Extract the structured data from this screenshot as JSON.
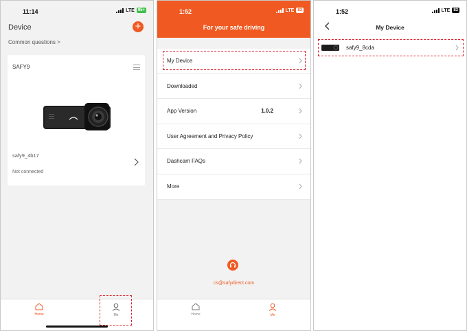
{
  "colors": {
    "accent": "#f05a22",
    "highlight": "#d9232e"
  },
  "panel1": {
    "time": "11:14",
    "network": "LTE",
    "battery": "95+",
    "title": "Device",
    "add_icon": "plus-icon",
    "common_questions": "Common questions >",
    "device_card": {
      "name": "SAFY9",
      "ssid": "safy9_4b17",
      "status": "Not connected"
    },
    "tabs": [
      {
        "label": "Home",
        "icon": "home-icon",
        "active": true
      },
      {
        "label": "Me",
        "icon": "user-icon",
        "active": false
      }
    ]
  },
  "panel2": {
    "time": "1:52",
    "network": "LTE",
    "battery": "83",
    "banner": "For your safe driving",
    "menu": [
      {
        "label": "My Device",
        "value": ""
      },
      {
        "label": "Downloaded",
        "value": ""
      },
      {
        "label": "App Version",
        "value": "1.0.2"
      },
      {
        "label": "User Agreement and Privacy Policy",
        "value": ""
      },
      {
        "label": "Dashcam FAQs",
        "value": ""
      },
      {
        "label": "More",
        "value": ""
      }
    ],
    "support_icon": "headset-icon",
    "email": "cs@safydirect.com",
    "tabs": [
      {
        "label": "Home",
        "icon": "home-icon",
        "active": false
      },
      {
        "label": "Me",
        "icon": "user-icon",
        "active": true
      }
    ]
  },
  "panel3": {
    "time": "1:52",
    "network": "LTE",
    "battery": "83",
    "title": "My Device",
    "device": "safy9_8cda"
  }
}
